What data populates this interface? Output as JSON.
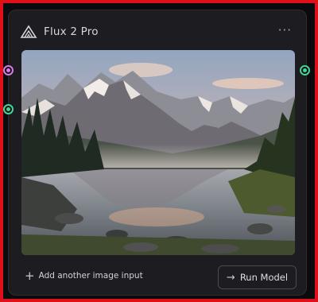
{
  "node": {
    "title": "Flux 2 Pro",
    "menu_label": "···",
    "image_alt": "Mountain lake landscape at sunset"
  },
  "footer": {
    "add_input_label": "Add another image input",
    "run_label": "Run Model"
  },
  "icons": {
    "logo": "flux-logo-icon",
    "menu": "more-dots-icon",
    "add": "plus-icon",
    "run": "arrow-right-icon"
  },
  "colors": {
    "frame_border": "#e0101a",
    "card_bg": "#1c1c21",
    "handle_purple": "#d77ae6",
    "handle_green": "#44d39a"
  }
}
